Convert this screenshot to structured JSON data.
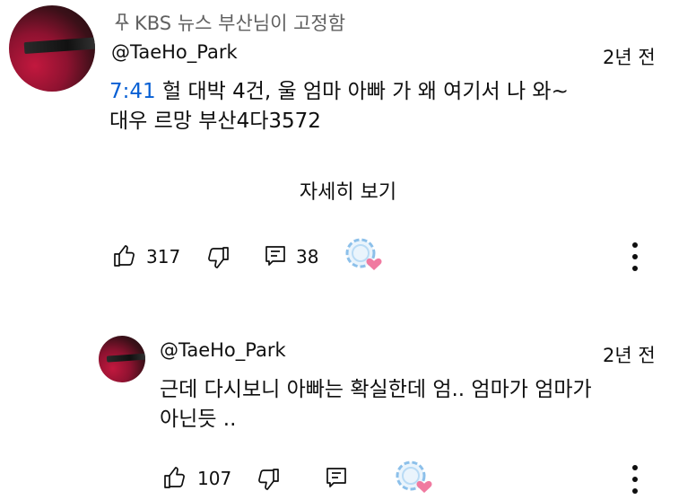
{
  "comment": {
    "pinned_label": "KBS 뉴스 부산님이 고정함",
    "author": "@TaeHo_Park",
    "time": "2년 전",
    "timestamp": "7:41",
    "text_line1_rest": " 헐 대박 4건,  울 엄마 아빠 가 왜 여기서 나 와~",
    "text_line2": "대우 르망 부산4다3572",
    "read_more": "자세히 보기",
    "likes": "317",
    "replies": "38"
  },
  "reply": {
    "author": "@TaeHo_Park",
    "time": "2년 전",
    "text_line1": "근데 다시보니 아빠는 확실한데 엄.. 엄마가 엄마가",
    "text_line2": "아닌듯 ..",
    "likes": "107"
  },
  "colors": {
    "timestamp_link": "#065fd4",
    "secondary_text": "#606060",
    "heart": "#f07aa0",
    "ring": "#7fb8e6"
  }
}
